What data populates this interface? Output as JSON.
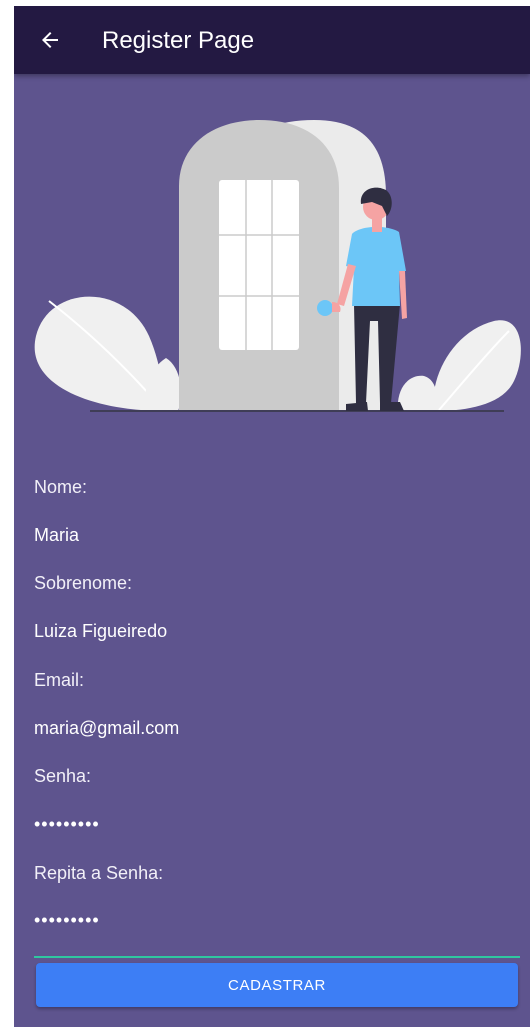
{
  "appbar": {
    "title": "Register Page",
    "back_icon": "arrow-left-icon"
  },
  "colors": {
    "appbar_bg": "#231942",
    "page_bg": "#5e548e",
    "button_bg": "#3d7ef5",
    "underline": "#2fc7a0"
  },
  "form": {
    "nome_label": "Nome:",
    "nome_value": "Maria",
    "sobrenome_label": "Sobrenome:",
    "sobrenome_value": "Luiza Figueiredo",
    "email_label": "Email:",
    "email_value": "maria@gmail.com",
    "senha_label": "Senha:",
    "senha_value": "•••••••••",
    "repita_label": "Repita a Senha:",
    "repita_value": "•••••••••",
    "submit_label": "CADASTRAR"
  }
}
